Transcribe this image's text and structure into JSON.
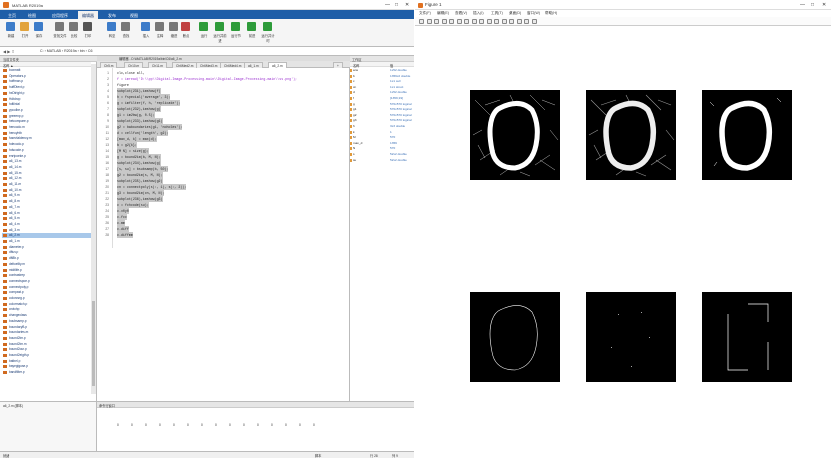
{
  "matlab": {
    "title": "MATLAB R2019a",
    "tabs": [
      "主页",
      "绘图",
      "应用程序",
      "编辑器",
      "发布",
      "视图"
    ],
    "active_tab": 3,
    "ribbon": {
      "buttons": [
        "新建",
        "打开",
        "保存",
        "查找文件",
        "比较",
        "打印",
        "转至",
        "查找",
        "插入",
        "注释",
        "缩进",
        "断点",
        "运行",
        "运行并前进",
        "运行节",
        "前进",
        "运行并计时"
      ]
    },
    "path": "C: › MATLAB › R2019a › bin › C6",
    "file_browser": {
      "header": "当前文件夹",
      "col_name": "名称 ▲",
      "files": [
        "boxmatt",
        "Operators.p",
        "hoffman.p",
        "huffDtext.p",
        "hxDtright.p",
        "Hdtdrop",
        "hdtlinial",
        "ypcolbe.p",
        "greeenp.p",
        "hetcompare.p",
        "hencodo.m",
        "hencyhtb",
        "fusevlaldency.m",
        "hdecodo.p",
        "hdscode.p",
        "enrtpoeke.p",
        "a6_13.m",
        "a6_14.m",
        "a6_15.m",
        "a6_12.m",
        "a6_11.m",
        "a6_10.m",
        "a6_9.m",
        "a6_8.m",
        "a6_7.m",
        "a6_6.m",
        "a6_5.m",
        "a6_4.m",
        "a6_3.m",
        "a6_2.m",
        "a6_1.m",
        "diameter.p",
        "dftuv.p",
        "dft8b.p",
        "deltoellty.m",
        "midtlife.p",
        "contrastrep",
        "connectspoe.p",
        "connectpoly.p",
        "compast.p",
        "colorcsrg.p",
        "colormatch.p",
        "crotchp",
        "changeclass",
        "boubsamp.p",
        "boundaryB.p",
        "boundaries.m",
        "bound2im.p",
        "bound2im.m",
        "bound2our.p",
        "bound2eigth.p",
        "batbel.p",
        "bayegiguse.p",
        "bandfilter.p"
      ],
      "selected_index": 29,
      "details_label": "a6_2.m  (脚本)"
    },
    "editor": {
      "title": "编辑器 - D:\\MATLAB\\R2019a\\bin\\C6\\a6_2.m",
      "tabs": [
        "Ch5.m",
        "Ch10.m",
        "Ch11.m",
        "Ch6Med2.m",
        "Ch6Med3.m",
        "Ch6Med4.m",
        "a6_1.m",
        "a6_2.m"
      ],
      "active_tab": 7,
      "lines": [
        {
          "n": "1",
          "text": "clc,close all,"
        },
        {
          "n": "2",
          "text": "f = imread('D:\\\\pp\\\\Digital-Image-Processing-main\\\\Digital-Image-Processing-main\\\\ss.png');",
          "string": true
        },
        {
          "n": "3",
          "text": "figure"
        },
        {
          "n": "4",
          "text": "subplot(231),imshow(f)",
          "hl": true
        },
        {
          "n": "5",
          "text": "h = fspecial('average', 3);",
          "hl": true
        },
        {
          "n": "6",
          "text": "g = imfilter(f, h, 'replicate');",
          "hl": true
        },
        {
          "n": "7",
          "text": "subplot(232),imshow(g)",
          "hl": true
        },
        {
          "n": "8",
          "text": "g1 = im2bw(g, 0.5);",
          "hl": true
        },
        {
          "n": "9",
          "text": "subplot(233),imshow(g1)",
          "hl": true
        },
        {
          "n": "10",
          "text": "g2 = bwboundaries(g1, 'noholes');",
          "hl": true
        },
        {
          "n": "11",
          "text": "d = cellfun('length', g2);",
          "hl": true
        },
        {
          "n": "12",
          "text": "[max_d, k] = max(d);",
          "hl": true
        },
        {
          "n": "13",
          "text": "b = g2{k};",
          "hl": true
        },
        {
          "n": "14",
          "text": "[M N] = size(g);",
          "hl": true
        },
        {
          "n": "15",
          "text": "g = bound2im(b, M, N);",
          "hl": true
        },
        {
          "n": "16",
          "text": "subplot(234),imshow(g)",
          "hl": true
        },
        {
          "n": "17",
          "text": "[s, su] = bsubsamp(b, 50);",
          "hl": true
        },
        {
          "n": "18",
          "text": "g2 = bound2im(s, M, N);",
          "hl": true
        },
        {
          "n": "19",
          "text": "subplot(235),imshow(g2)",
          "hl": true
        },
        {
          "n": "20",
          "text": "cn = connectpoly(s(:, 1), s(:, 2));",
          "hl": true
        },
        {
          "n": "21",
          "text": "g3 = bound2im(cn, M, N);",
          "hl": true
        },
        {
          "n": "22",
          "text": "subplot(236),imshow(g3)",
          "hl": true
        },
        {
          "n": "23",
          "text": "c = fchcode(su);",
          "hl": true
        },
        {
          "n": "24",
          "text": "c.x0y0",
          "hl": true
        },
        {
          "n": "25",
          "text": "c.fcc",
          "hl": true
        },
        {
          "n": "26",
          "text": "c.mm",
          "hl": true
        },
        {
          "n": "27",
          "text": "c.diff",
          "hl": true
        },
        {
          "n": "28",
          "text": "c.diffmm",
          "hl": true
        }
      ]
    },
    "workspace": {
      "header": "工作区",
      "col_name": "名称",
      "col_value": "值",
      "vars": [
        {
          "n": "ans",
          "v": "1x52 double"
        },
        {
          "n": "b",
          "v": "1359x2 double"
        },
        {
          "n": "c",
          "v": "1x1 cell"
        },
        {
          "n": "cn",
          "v": "1x1 struct"
        },
        {
          "n": "d",
          "v": "1x52 double"
        },
        {
          "n": "f",
          "v": "[1359;19]"
        },
        {
          "n": "g",
          "v": "570x570 logical"
        },
        {
          "n": "g1",
          "v": "570x570 logical"
        },
        {
          "n": "g2",
          "v": "570x570 logical"
        },
        {
          "n": "g3",
          "v": "570x570 logical"
        },
        {
          "n": "h",
          "v": "3x3 double"
        },
        {
          "n": "k",
          "v": "1"
        },
        {
          "n": "M",
          "v": "570"
        },
        {
          "n": "max_d",
          "v": "1359"
        },
        {
          "n": "N",
          "v": "570"
        },
        {
          "n": "s",
          "v": "52x2 double"
        },
        {
          "n": "su",
          "v": "52x2 double"
        }
      ]
    },
    "command_window": {
      "header": "命令行窗口",
      "values": [
        "0",
        "0",
        "0",
        "0",
        "0",
        "0",
        "0",
        "0",
        "0",
        "0",
        "0",
        "0",
        "0",
        "0",
        "0"
      ]
    },
    "status": {
      "left": "就绪",
      "mid": "脚本",
      "ln": "行 28",
      "col": "列 9"
    }
  },
  "figure": {
    "title": "Figure 1",
    "menu": [
      "文件(F)",
      "编辑(E)",
      "查看(V)",
      "插入(I)",
      "工具(T)",
      "桌面(D)",
      "窗口(W)",
      "帮助(H)"
    ],
    "watermark": "CSDN @apple_51774285"
  }
}
